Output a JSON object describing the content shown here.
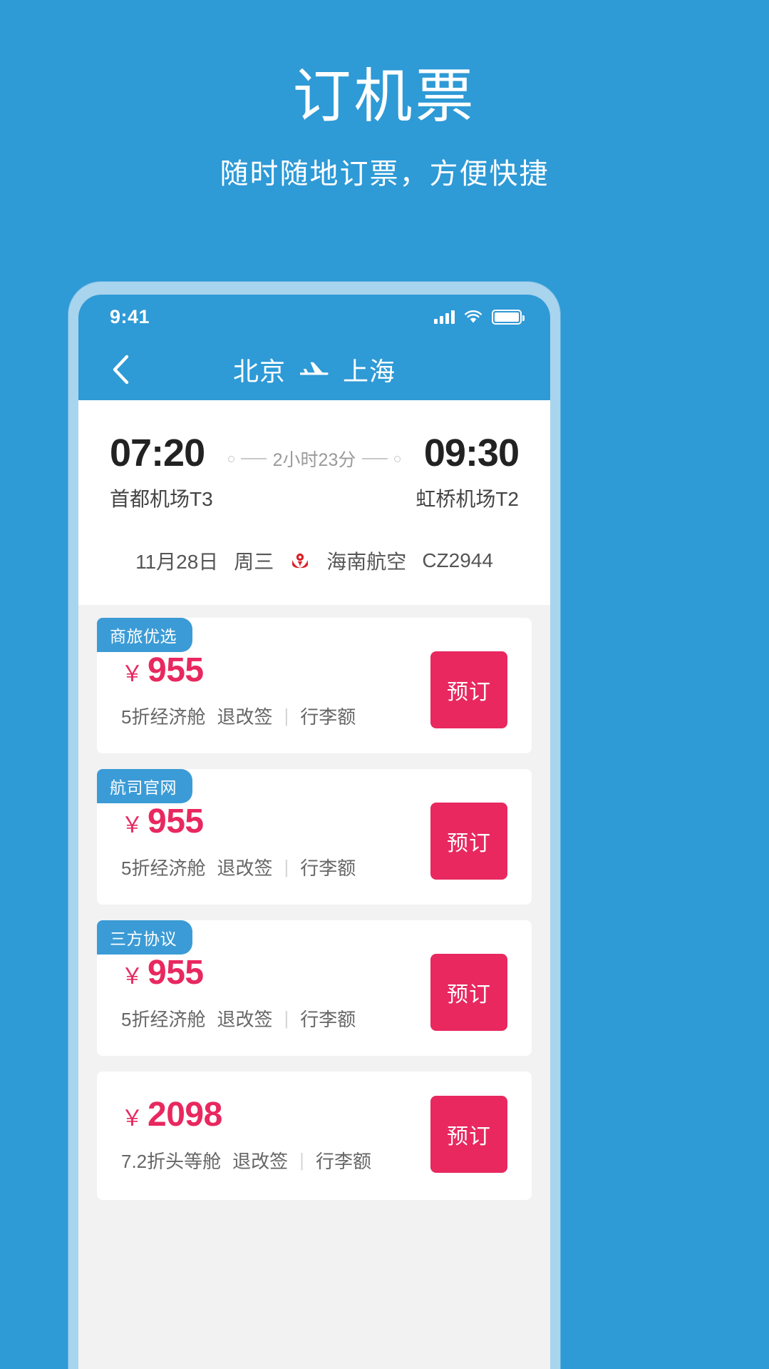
{
  "promo": {
    "title": "订机票",
    "subtitle": "随时随地订票，方便快捷"
  },
  "colors": {
    "brand_blue": "#2E9AD6",
    "frame_blue": "#A9D4EE",
    "badge_blue": "#3B9BD6",
    "price_pink": "#E8285F",
    "page_bg": "#F2F2F2"
  },
  "statusbar": {
    "time": "9:41",
    "signal_icon": "signal-bars-icon",
    "wifi_icon": "wifi-icon",
    "battery_icon": "battery-icon"
  },
  "navbar": {
    "back_icon": "chevron-left-icon",
    "origin": "北京",
    "plane_icon": "airplane-icon",
    "destination": "上海"
  },
  "flight": {
    "depart_time": "07:20",
    "depart_airport": "首都机场T3",
    "duration": "2小时23分",
    "arrive_time": "09:30",
    "arrive_airport": "虹桥机场T2",
    "date": "11月28日",
    "weekday": "周三",
    "airline_logo_icon": "hainan-airlines-logo-icon",
    "airline": "海南航空",
    "flight_no": "CZ2944"
  },
  "tickets": [
    {
      "badge": "商旅优选",
      "currency": "￥",
      "price": "955",
      "cabin": "5折经济舱",
      "refund": "退改签",
      "separator": "|",
      "baggage": "行李额",
      "book_label": "预订"
    },
    {
      "badge": "航司官网",
      "currency": "￥",
      "price": "955",
      "cabin": "5折经济舱",
      "refund": "退改签",
      "separator": "|",
      "baggage": "行李额",
      "book_label": "预订"
    },
    {
      "badge": "三方协议",
      "currency": "￥",
      "price": "955",
      "cabin": "5折经济舱",
      "refund": "退改签",
      "separator": "|",
      "baggage": "行李额",
      "book_label": "预订"
    },
    {
      "badge": "",
      "currency": "￥",
      "price": "2098",
      "cabin": "7.2折头等舱",
      "refund": "退改签",
      "separator": "|",
      "baggage": "行李额",
      "book_label": "预订"
    }
  ]
}
